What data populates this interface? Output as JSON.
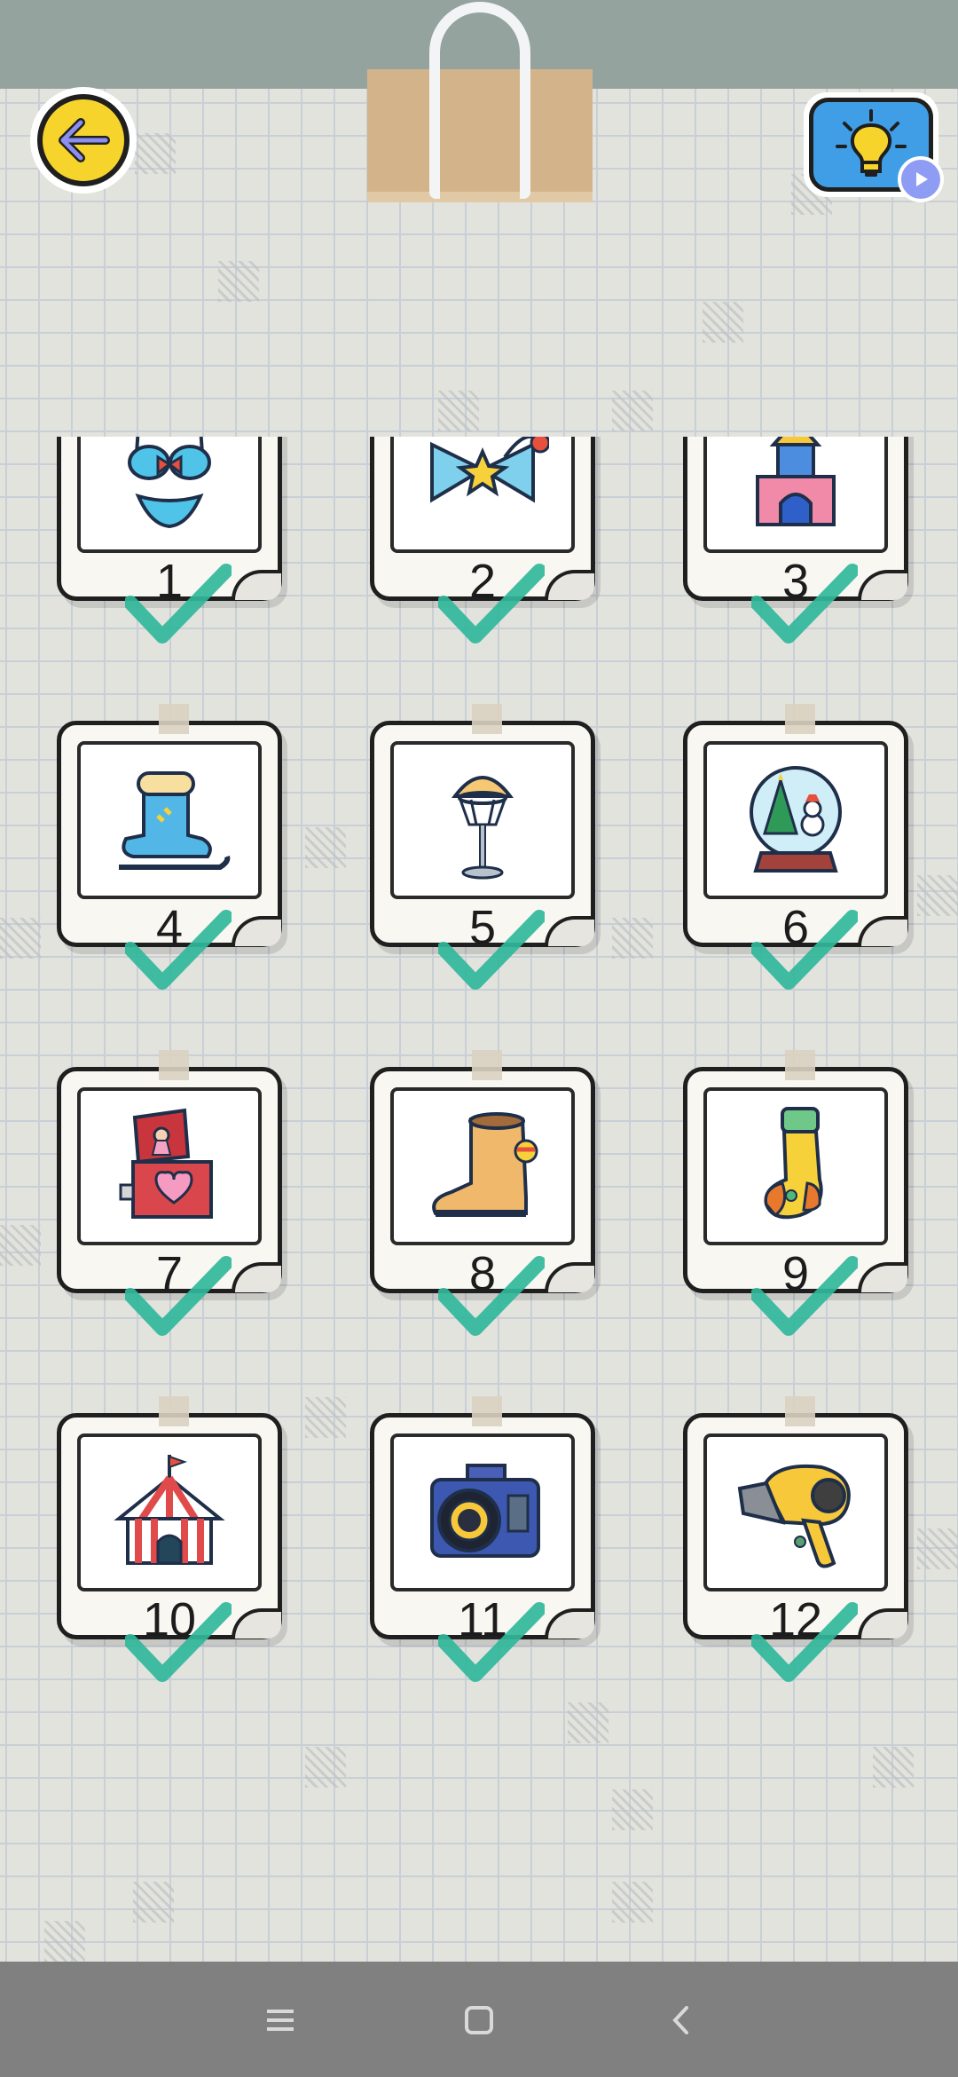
{
  "app": {
    "accent": "#31b79b",
    "card_border": "#1f1f1f",
    "back_button_color": "#f7d42c",
    "hint_button_color": "#3f9ee6"
  },
  "top_bar": {
    "back_icon": "arrow-left-icon",
    "hint_icon": "lightbulb-icon",
    "hint_badge_icon": "play-video-icon"
  },
  "levels": [
    {
      "number": "1",
      "item": "bikini-icon",
      "completed": true
    },
    {
      "number": "2",
      "item": "bow-hair-tie-icon",
      "completed": true
    },
    {
      "number": "3",
      "item": "toy-block-castle-icon",
      "completed": true
    },
    {
      "number": "4",
      "item": "ice-skate-icon",
      "completed": true
    },
    {
      "number": "5",
      "item": "basketball-hoop-icon",
      "completed": true
    },
    {
      "number": "6",
      "item": "snow-globe-icon",
      "completed": true
    },
    {
      "number": "7",
      "item": "music-box-icon",
      "completed": true
    },
    {
      "number": "8",
      "item": "boot-icon",
      "completed": true
    },
    {
      "number": "9",
      "item": "sock-icon",
      "completed": true
    },
    {
      "number": "10",
      "item": "circus-tent-icon",
      "completed": true
    },
    {
      "number": "11",
      "item": "camera-icon",
      "completed": true
    },
    {
      "number": "12",
      "item": "hair-dryer-icon",
      "completed": true
    }
  ],
  "nav": {
    "menu_icon": "recents-icon",
    "home_icon": "home-icon",
    "back_icon": "nav-back-icon"
  }
}
